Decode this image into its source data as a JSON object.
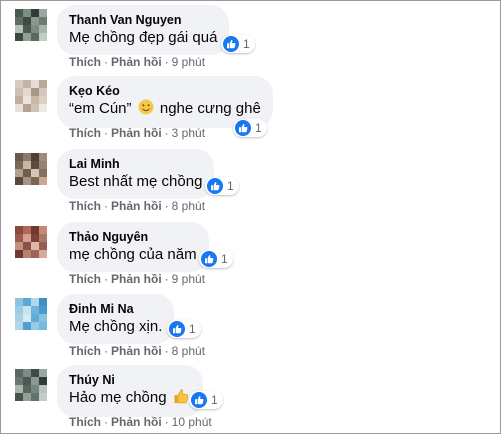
{
  "colors": {
    "bubble": "#f0f2f5",
    "like": "#1877f2",
    "meta": "#65676b",
    "text": "#050505"
  },
  "comments": [
    {
      "name": "Thanh Van Nguyen",
      "text": "Mẹ chồng đẹp gái quá",
      "reaction_count": "1",
      "like_label": "Thích",
      "reply_label": "Phản hồi",
      "time": "9 phút",
      "avatar_colors": [
        "#4a5a4c",
        "#7a8c84",
        "#2e3d34",
        "#9aa8a0",
        "#5c6e62",
        "#3c4a40",
        "#8a9890",
        "#6c7c72",
        "#b4c0b8",
        "#485a4e",
        "#7c8a82",
        "#a6b2aa",
        "#3a4a3e",
        "#90a096",
        "#5a6a5e",
        "#c2ccc6"
      ]
    },
    {
      "name": "Kẹo Kéo",
      "text_before": "“em Cún”",
      "emoji": "smiling-face-icon",
      "text_after": "nghe cưng ghê",
      "reaction_count": "1",
      "like_label": "Thích",
      "reply_label": "Phản hồi",
      "time": "3 phút",
      "avatar_colors": [
        "#d8ccc0",
        "#c4b4a6",
        "#e6ddd4",
        "#b8a898",
        "#cdbfb2",
        "#e2d8ce",
        "#a89888",
        "#d4c6ba",
        "#bfae9e",
        "#ece4dc",
        "#c8b8aa",
        "#dcd0c4",
        "#e8e0d8",
        "#b2a292",
        "#d0c2b4",
        "#f0eae4"
      ]
    },
    {
      "name": "Lai Minh",
      "text": "Best nhất mẹ chồng",
      "reaction_count": "1",
      "like_label": "Thích",
      "reply_label": "Phản hồi",
      "time": "8 phút",
      "avatar_colors": [
        "#6a5a4c",
        "#8c7a6a",
        "#4e4036",
        "#a08c7a",
        "#7a6858",
        "#c8b6a2",
        "#5c4c40",
        "#96826e",
        "#b4a08c",
        "#6e5e50",
        "#d6c6b4",
        "#846e5c",
        "#5a4a3e",
        "#a89482",
        "#786656",
        "#caa890"
      ]
    },
    {
      "name": "Thảo Nguyên",
      "text": "mẹ chồng của năm",
      "reaction_count": "1",
      "like_label": "Thích",
      "reply_label": "Phản hồi",
      "time": "9 phút",
      "avatar_colors": [
        "#8c4a3e",
        "#b0685a",
        "#6e3a30",
        "#c88a78",
        "#9e5a4a",
        "#d6a090",
        "#7c4438",
        "#a8786a",
        "#c09080",
        "#8a5246",
        "#e0b8a8",
        "#965e50",
        "#6a3c34",
        "#b88272",
        "#a06456",
        "#d8aa98"
      ]
    },
    {
      "name": "Đinh Mi Na",
      "text": "Mẹ chồng xịn.",
      "reaction_count": "1",
      "like_label": "Thích",
      "reply_label": "Phản hồi",
      "time": "8 phút",
      "avatar_colors": [
        "#8ac4e0",
        "#5aa8d4",
        "#b4d8ea",
        "#3c90c4",
        "#9ccee4",
        "#c8e2f0",
        "#70b4da",
        "#4a9acc",
        "#a8d2e6",
        "#d6eaf4",
        "#62acd6",
        "#88c2e0",
        "#b0d6ea",
        "#4e9ecf",
        "#96cbe3",
        "#74b8dc"
      ]
    },
    {
      "name": "Thúy Ni",
      "text_before": "Hảo mẹ chồng",
      "emoji": "thumbs-up-emoji-icon",
      "text_after": "",
      "reaction_count": "1",
      "like_label": "Thích",
      "reply_label": "Phản hồi",
      "time": "10 phút",
      "avatar_colors": [
        "#5a6a62",
        "#7c8c84",
        "#3e4c46",
        "#9aa8a2",
        "#687870",
        "#4a5a52",
        "#8a9a92",
        "#2e3c36",
        "#a8b4ae",
        "#56665e",
        "#76867e",
        "#b8c2bc",
        "#44544c",
        "#90a098",
        "#62726a",
        "#c4ccc8"
      ]
    }
  ]
}
